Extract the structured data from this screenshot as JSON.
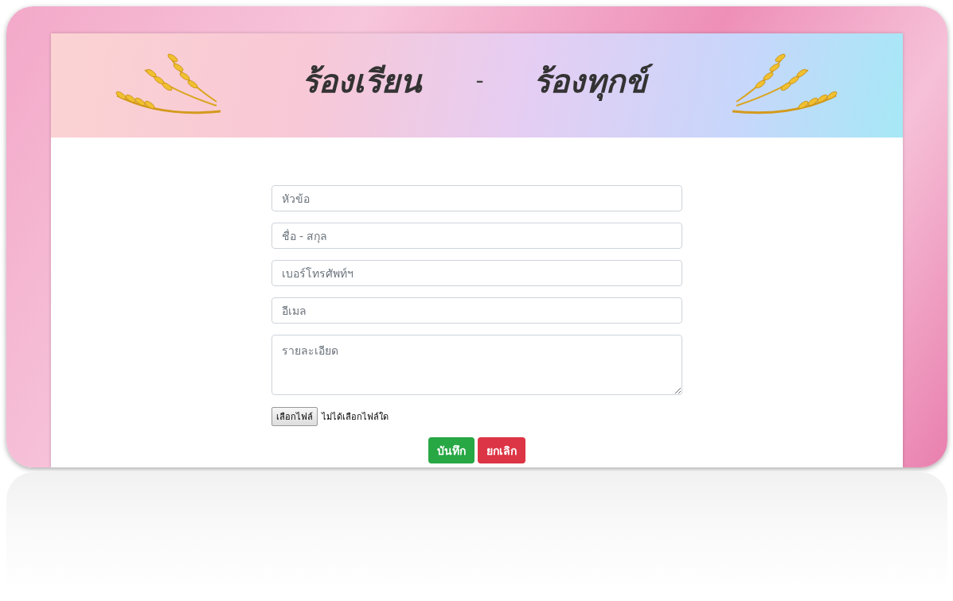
{
  "banner": {
    "title_parts": [
      "ร้องเรียน",
      "-",
      "ร้องทุกข์"
    ]
  },
  "form": {
    "fields": [
      {
        "kind": "input",
        "placeholder": "หัวข้อ"
      },
      {
        "kind": "input",
        "placeholder": "ชื่อ - สกุล"
      },
      {
        "kind": "input",
        "placeholder": "เบอร์โทรศัพท์ฯ"
      },
      {
        "kind": "input",
        "placeholder": "อีเมล"
      },
      {
        "kind": "textarea",
        "placeholder": "รายละเอียด"
      }
    ],
    "file_picker": {
      "button": "เลือกไฟล์",
      "status": "ไม่ได้เลือกไฟล์ใด"
    },
    "buttons": [
      {
        "label": "บันทึก",
        "kind": "success"
      },
      {
        "label": "ยกเลิก",
        "kind": "danger"
      }
    ]
  }
}
